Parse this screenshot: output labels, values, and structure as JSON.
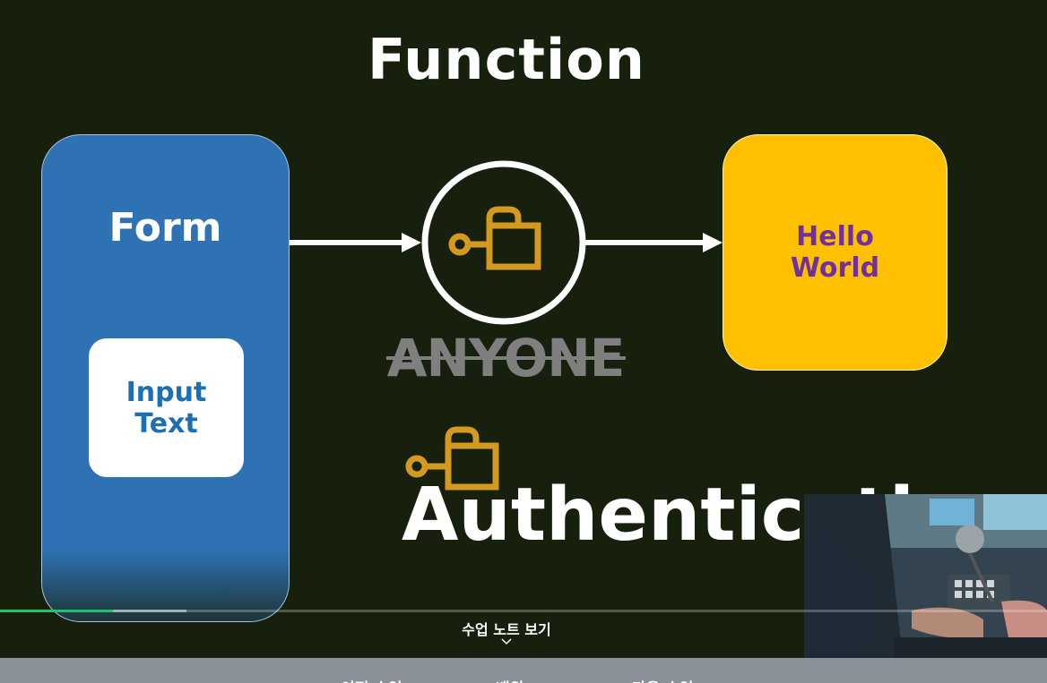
{
  "slide": {
    "title": "Function",
    "form_label": "Form",
    "input_text_label": "Input\nText",
    "hello_label": "Hello\nWorld",
    "anyone_label": "ANYONE",
    "auth_label": "Authenticati"
  },
  "player": {
    "notes_button_label": "수업 노트 보기",
    "progress_played": 0.108,
    "progress_buffered": 0.178
  },
  "bottom_bar": {
    "prev_label": "< 이전 수업",
    "center_label": "배워",
    "next_label": "다음 수업 >"
  },
  "colors": {
    "background": "#17200c",
    "form_blue": "#2e72b4",
    "hello_yellow": "#ffc000",
    "hello_text": "#7030a0",
    "lock_gold": "#d49a1f",
    "progress_green": "#20c36b"
  },
  "icons": [
    "lock-open-icon",
    "arrow-right-icon",
    "chevron-down-icon"
  ]
}
